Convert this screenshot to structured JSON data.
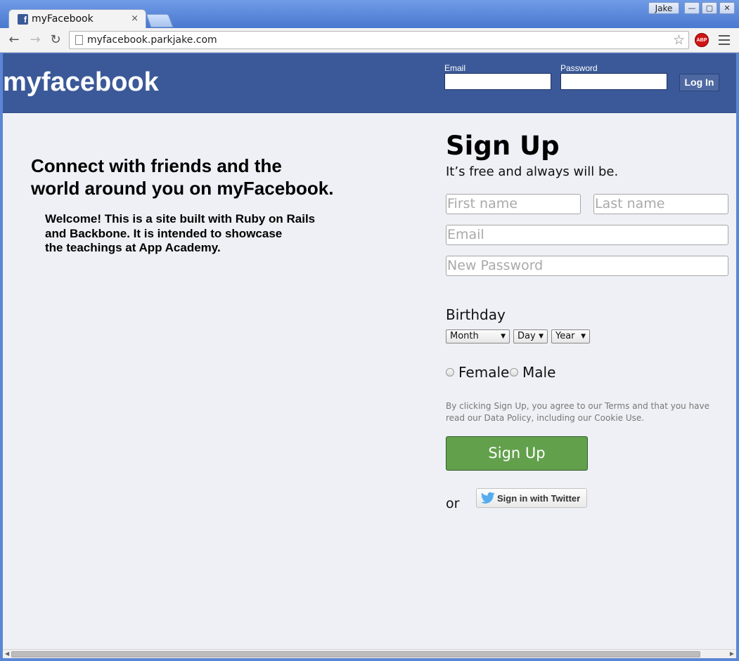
{
  "browser": {
    "tab_title": "myFacebook",
    "tab_close": "×",
    "user_name": "Jake",
    "url": "myfacebook.parkjake.com",
    "adblock_label": "ABP",
    "window_buttons": {
      "minimize": "—",
      "maximize": "▢",
      "close": "✕"
    }
  },
  "header": {
    "logo": "myfacebook",
    "email_label": "Email",
    "password_label": "Password",
    "login_label": "Log In"
  },
  "intro": {
    "headline_line1": "Connect with friends and the",
    "headline_line2": "world around you on myFacebook.",
    "welcome_line1": "Welcome! This is a site built with Ruby on Rails",
    "welcome_line2": "and Backbone. It is intended to showcase",
    "welcome_line3": "the teachings at App Academy."
  },
  "signup": {
    "title": "Sign Up",
    "subtitle": "It’s free and always will be.",
    "first_name_placeholder": "First name",
    "last_name_placeholder": "Last name",
    "email_placeholder": "Email",
    "password_placeholder": "New Password",
    "birthday_label": "Birthday",
    "month": "Month",
    "day": "Day",
    "year": "Year",
    "female_label": "Female",
    "male_label": "Male",
    "terms_line1": "By clicking Sign Up, you agree to our Terms and that you have",
    "terms_line2": "read our Data Policy, including our Cookie Use.",
    "button_label": "Sign Up",
    "or_label": "or",
    "twitter_label": "Sign in with Twitter"
  },
  "colors": {
    "header_blue": "#3b5998",
    "signup_green": "#62a04c",
    "page_bg": "#eff0f5"
  }
}
